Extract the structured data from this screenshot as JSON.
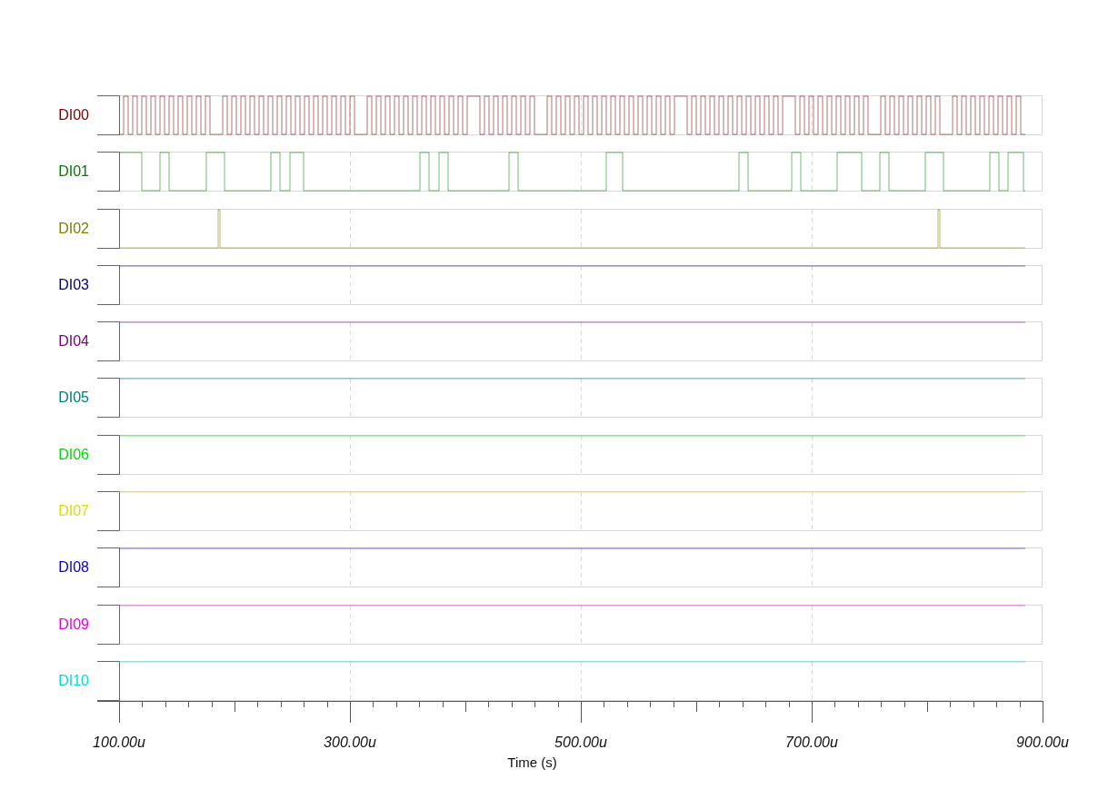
{
  "channels": [
    {
      "name": "DI00",
      "color": "#800000"
    },
    {
      "name": "DI01",
      "color": "#008000"
    },
    {
      "name": "DI02",
      "color": "#808000"
    },
    {
      "name": "DI03",
      "color": "#000080"
    },
    {
      "name": "DI04",
      "color": "#800080"
    },
    {
      "name": "DI05",
      "color": "#008080"
    },
    {
      "name": "DI06",
      "color": "#00dd00"
    },
    {
      "name": "DI07",
      "color": "#dddd00"
    },
    {
      "name": "DI08",
      "color": "#0000ee"
    },
    {
      "name": "DI09",
      "color": "#ee00ee"
    },
    {
      "name": "DI10",
      "color": "#00dddd"
    }
  ],
  "axis": {
    "ticks": [
      "100.00u",
      "300.00u",
      "500.00u",
      "700.00u",
      "900.00u"
    ],
    "title": "Time (s)"
  }
}
